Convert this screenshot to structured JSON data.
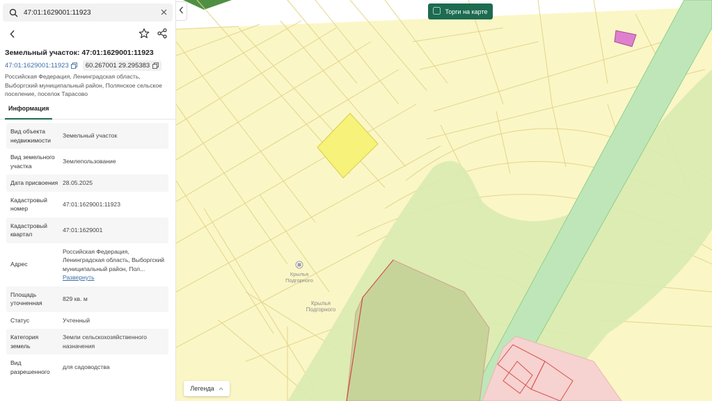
{
  "search": {
    "value": "47:01:1629001:11923",
    "placeholder": ""
  },
  "parcel": {
    "title": "Земельный участок: 47:01:1629001:11923",
    "cadastral_link": "47:01:1629001:11923",
    "coords": "60.267001 29.295383",
    "address": "Российская Федерация, Ленинградская область, Выборгский муниципальный район, Полянское сельское поселение, поселок Тарасово"
  },
  "tabs": [
    {
      "label": "Информация"
    }
  ],
  "properties": [
    {
      "key": "Вид объекта недвижимости",
      "value": "Земельный участок"
    },
    {
      "key": "Вид земельного участка",
      "value": "Землепользование"
    },
    {
      "key": "Дата присвоения",
      "value": "28.05.2025"
    },
    {
      "key": "Кадастровый номер",
      "value": "47:01:1629001:11923"
    },
    {
      "key": "Кадастровый квартал",
      "value": "47:01:1629001"
    },
    {
      "key": "Адрес",
      "value": "Российская Федерация, Ленинградская область, Выборгский муниципальный район, Пол...",
      "link": "Развернуть"
    },
    {
      "key": "Площадь уточненная",
      "value": "829 кв. м"
    },
    {
      "key": "Статус",
      "value": "Учтенный"
    },
    {
      "key": "Категория земель",
      "value": "Земли сельскохозяйственного назначения"
    },
    {
      "key": "Вид разрешенного",
      "value": "для садоводства"
    }
  ],
  "map": {
    "auction_button": "Торги на карте",
    "legend_button": "Легенда",
    "poi_label": "Крылья Подгорного",
    "area_label": "Крылья Подгорного"
  },
  "colors": {
    "accent": "#1d6b51",
    "parcel_fill": "#fbf6c6",
    "parcel_stroke": "#e2d58a",
    "selected_parcel": "#f6f27a",
    "forest": "#d9ebb0",
    "stream": "#bfe6b8",
    "buildings": "#f6d2d0"
  }
}
